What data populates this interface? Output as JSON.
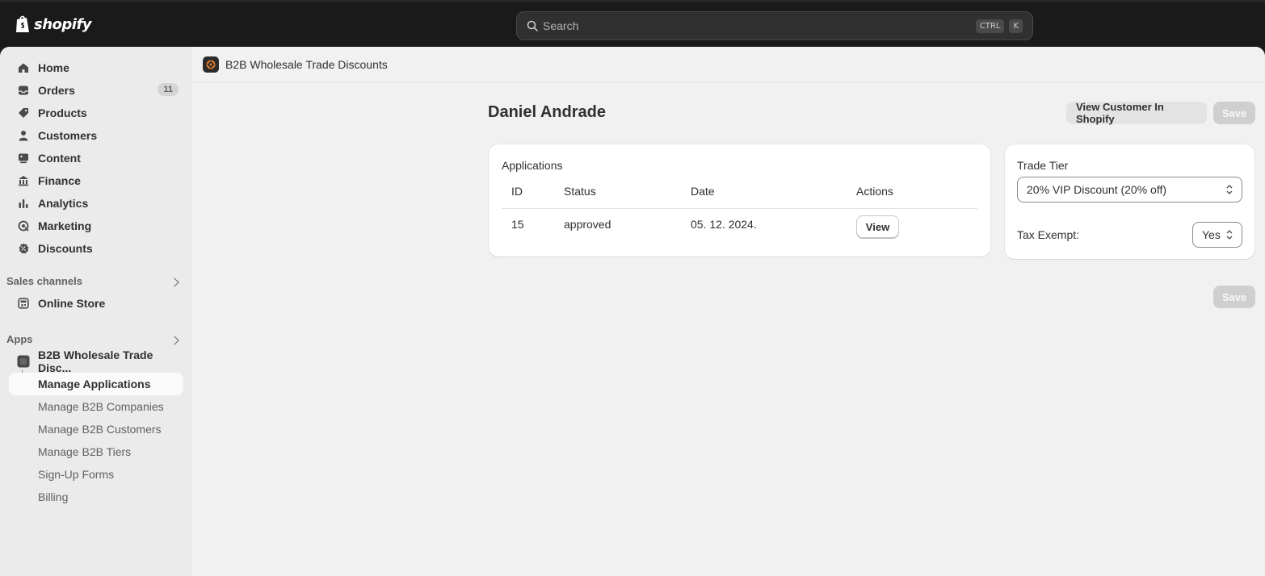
{
  "topbar": {
    "brand": "shopify",
    "search_placeholder": "Search",
    "shortcut_keys": [
      "CTRL",
      "K"
    ]
  },
  "sidebar": {
    "items": [
      {
        "label": "Home",
        "icon": "home-icon"
      },
      {
        "label": "Orders",
        "icon": "inbox-icon",
        "badge": "11"
      },
      {
        "label": "Products",
        "icon": "tag-icon"
      },
      {
        "label": "Customers",
        "icon": "person-icon"
      },
      {
        "label": "Content",
        "icon": "content-icon"
      },
      {
        "label": "Finance",
        "icon": "bank-icon"
      },
      {
        "label": "Analytics",
        "icon": "bar-chart-icon"
      },
      {
        "label": "Marketing",
        "icon": "target-icon"
      },
      {
        "label": "Discounts",
        "icon": "discount-icon"
      }
    ],
    "sales_channels": {
      "title": "Sales channels",
      "items": [
        {
          "label": "Online Store",
          "icon": "store-icon"
        }
      ]
    },
    "apps": {
      "title": "Apps",
      "app_name": "B2B Wholesale Trade Disc...",
      "sub_items": [
        {
          "label": "Manage Applications",
          "active": true
        },
        {
          "label": "Manage B2B Companies",
          "active": false
        },
        {
          "label": "Manage B2B Customers",
          "active": false
        },
        {
          "label": "Manage B2B Tiers",
          "active": false
        },
        {
          "label": "Sign-Up Forms",
          "active": false
        },
        {
          "label": "Billing",
          "active": false
        }
      ]
    }
  },
  "app_header": {
    "title": "B2B Wholesale Trade Discounts"
  },
  "page": {
    "title": "Daniel Andrade",
    "view_customer_label": "View Customer In Shopify",
    "save_label": "Save"
  },
  "applications": {
    "title": "Applications",
    "columns": [
      "ID",
      "Status",
      "Date",
      "Actions"
    ],
    "rows": [
      {
        "id": "15",
        "status": "approved",
        "date": "05. 12. 2024.",
        "action": "View"
      }
    ]
  },
  "settings": {
    "trade_tier_label": "Trade Tier",
    "trade_tier_value": "20% VIP Discount (20% off)",
    "tax_exempt_label": "Tax Exempt:",
    "tax_exempt_value": "Yes"
  },
  "colors": {
    "topbar": "#1a1a1a",
    "sidebar": "#ebebeb",
    "main": "#f1f1f1",
    "card": "#ffffff",
    "disabled_button": "#cfcfcf"
  }
}
